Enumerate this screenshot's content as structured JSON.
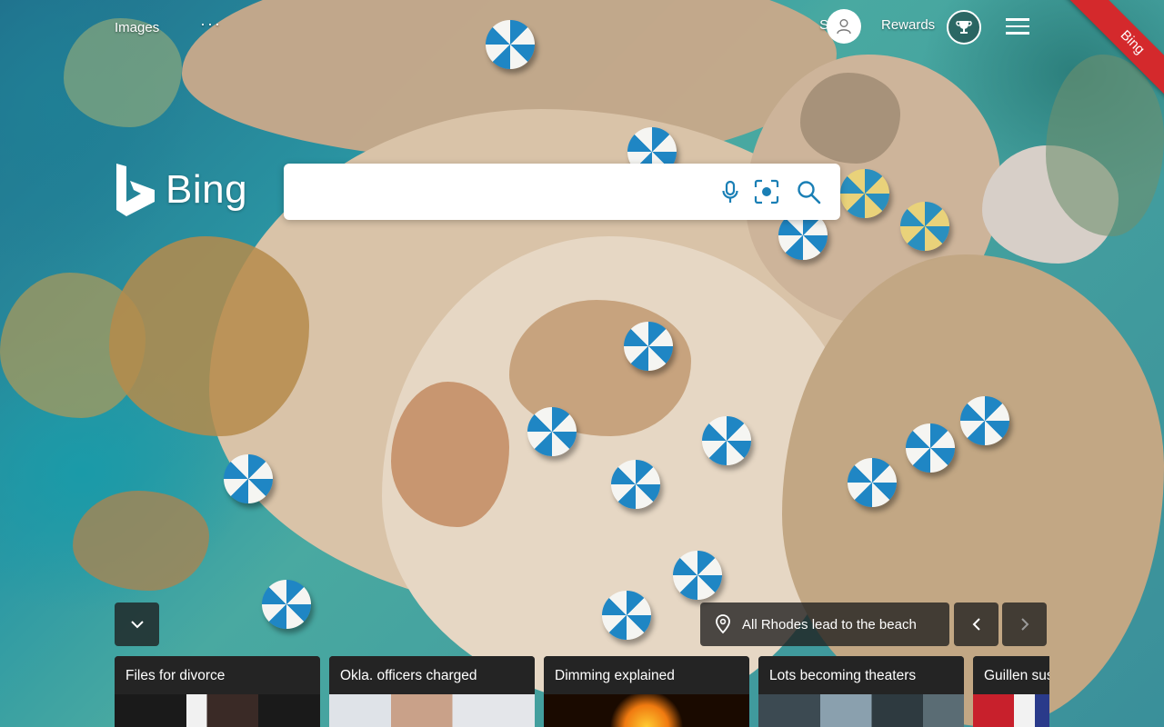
{
  "header": {
    "images_label": "Images",
    "more_label": "···",
    "signin_label": "Sign in",
    "rewards_label": "Rewards",
    "ribbon_label": "Bing"
  },
  "logo": {
    "text": "Bing"
  },
  "search": {
    "value": "",
    "placeholder": ""
  },
  "image_info": {
    "title": "All Rhodes lead to the beach"
  },
  "news": [
    {
      "label": "Files for divorce"
    },
    {
      "label": "Okla. officers charged"
    },
    {
      "label": "Dimming explained"
    },
    {
      "label": "Lots becoming theaters"
    },
    {
      "label": "Guillen sus"
    }
  ],
  "colors": {
    "ribbon": "#d4292c",
    "accent_icon": "#1a7fb5",
    "overlay": "#1e1e1e"
  },
  "icons": [
    "user-icon",
    "trophy-icon",
    "menu-icon",
    "microphone-icon",
    "visual-search-icon",
    "search-icon",
    "chevron-down-icon",
    "location-pin-icon",
    "chevron-left-icon",
    "chevron-right-icon"
  ]
}
